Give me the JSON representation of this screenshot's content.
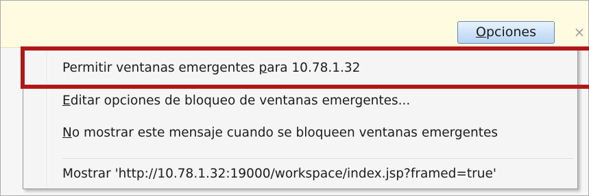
{
  "notification_bar": {
    "options_button": {
      "label_mnemonic": "O",
      "label_rest": "pciones"
    },
    "close_icon": "×"
  },
  "popup_menu": {
    "items": [
      {
        "before": "Permitir ventanas emergentes ",
        "mnemonic": "p",
        "after": "ara 10.78.1.32"
      },
      {
        "before": "",
        "mnemonic": "E",
        "after": "ditar opciones de bloqueo de ventanas emergentes..."
      },
      {
        "before": "",
        "mnemonic": "N",
        "after": "o mostrar este mensaje cuando se bloqueen ventanas emergentes"
      },
      {
        "before": "",
        "mnemonic": "",
        "after": "Mostrar 'http://10.78.1.32:19000/workspace/index.jsp?framed=true'"
      }
    ]
  },
  "highlight": {
    "color": "#b01818"
  }
}
